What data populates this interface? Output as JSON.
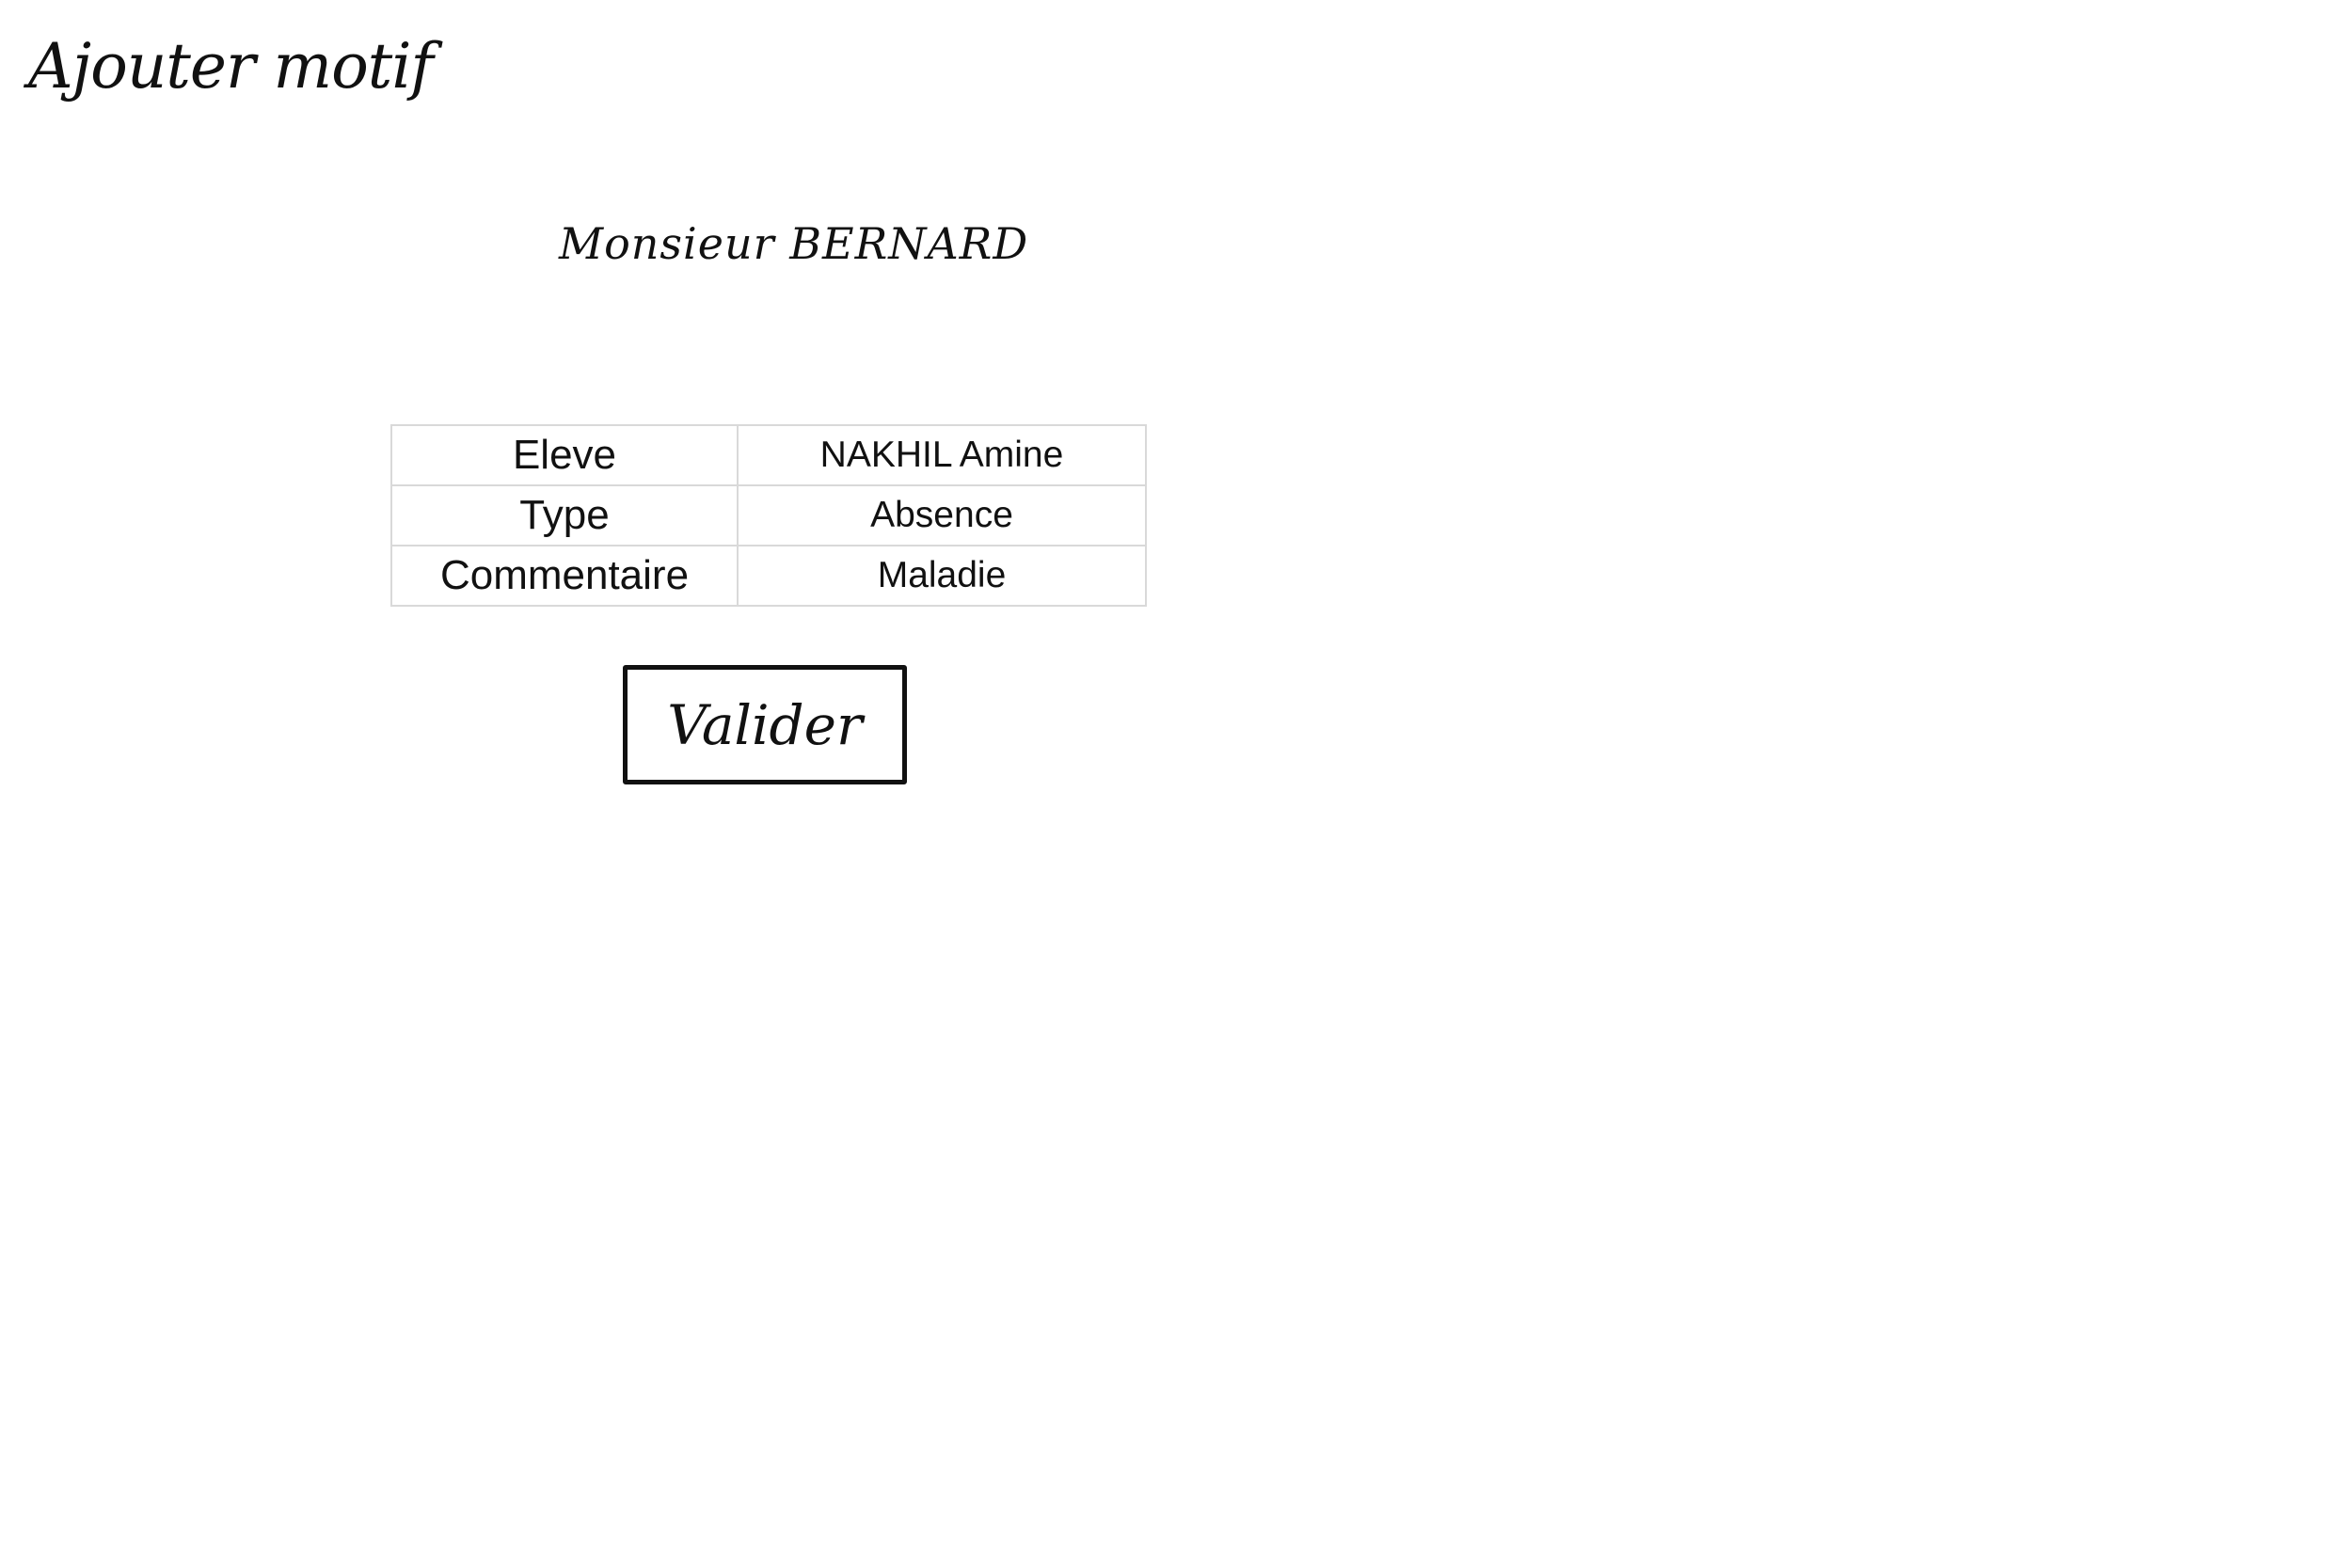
{
  "page": {
    "title": "Ajouter motif",
    "teacher_name": "Monsieur BERNARD"
  },
  "details": {
    "rows": [
      {
        "label": "Eleve",
        "value": "NAKHIL Amine"
      },
      {
        "label": "Type",
        "value": "Absence"
      },
      {
        "label": "Commentaire",
        "value": "Maladie"
      }
    ]
  },
  "actions": {
    "validate_label": "Valider"
  }
}
